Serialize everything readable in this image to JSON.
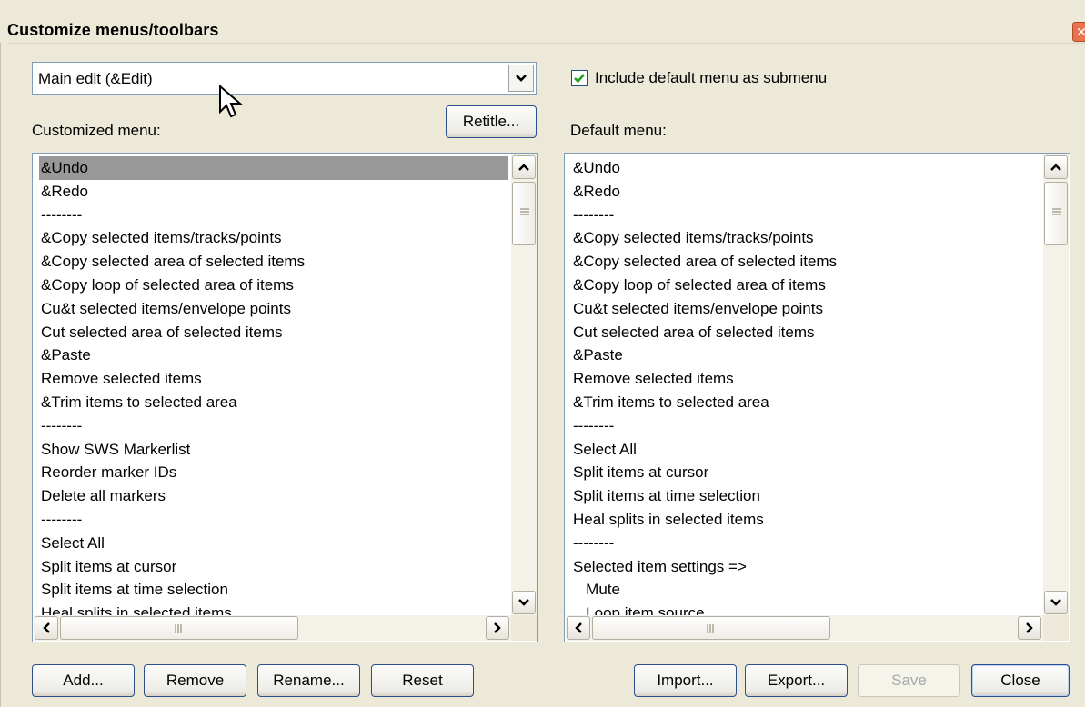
{
  "window": {
    "title": "Customize menus/toolbars"
  },
  "menu_select": {
    "value": "Main edit (&Edit)"
  },
  "include_default": {
    "label": "Include default menu as submenu",
    "checked": true
  },
  "customized": {
    "label": "Customized menu:",
    "retitle_label": "Retitle...",
    "items": [
      "&Undo",
      "&Redo",
      "--------",
      "&Copy selected items/tracks/points",
      "&Copy selected area of selected items",
      "&Copy loop of selected area of items",
      "Cu&t selected items/envelope points",
      "Cut selected area of selected items",
      "&Paste",
      "Remove selected items",
      "&Trim items to selected area",
      "--------",
      "Show SWS Markerlist",
      "Reorder marker IDs",
      "Delete all markers",
      "--------",
      "Select All",
      "Split items at cursor",
      "Split items at time selection",
      "Heal splits in selected items"
    ],
    "selected_index": 0
  },
  "default": {
    "label": "Default menu:",
    "items": [
      "&Undo",
      "&Redo",
      "--------",
      "&Copy selected items/tracks/points",
      "&Copy selected area of selected items",
      "&Copy loop of selected area of items",
      "Cu&t selected items/envelope points",
      "Cut selected area of selected items",
      "&Paste",
      "Remove selected items",
      "&Trim items to selected area",
      "--------",
      "Select All",
      "Split items at cursor",
      "Split items at time selection",
      "Heal splits in selected items",
      "--------",
      "Selected item settings =>",
      "   Mute",
      "   Loop item source"
    ]
  },
  "buttons": {
    "add": "Add...",
    "remove": "Remove",
    "rename": "Rename...",
    "reset": "Reset",
    "import": "Import...",
    "export": "Export...",
    "save": "Save",
    "close": "Close"
  },
  "colors": {
    "dialog_bg": "#ece9d8",
    "selection_bg": "#999999",
    "button_border": "#2b4e8c",
    "checkbox_check": "#21a121"
  }
}
